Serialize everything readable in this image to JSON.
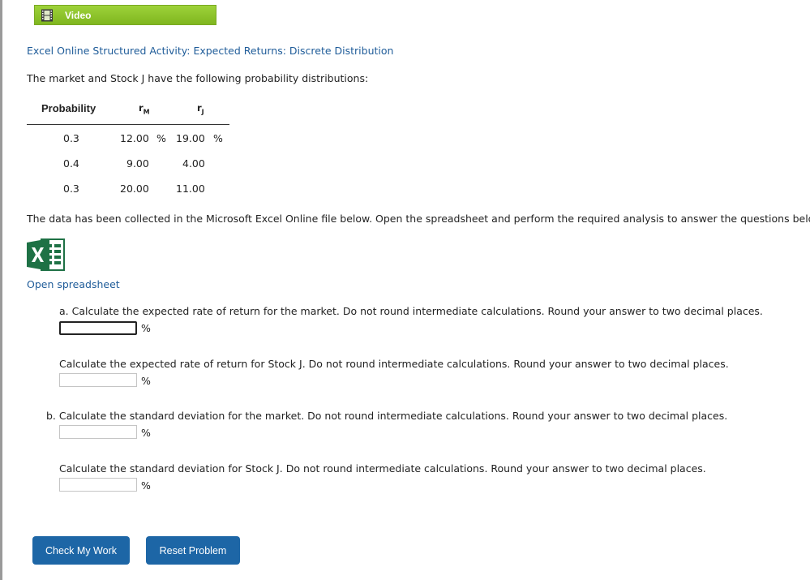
{
  "video": {
    "label": "Video",
    "icon": "film-icon"
  },
  "activity_title": "Excel Online Structured Activity: Expected Returns: Discrete Distribution",
  "intro": "The market and Stock J have the following probability distributions:",
  "table": {
    "header": {
      "probability": "Probability",
      "rm": "r",
      "rm_sub": "M",
      "rj": "r",
      "rj_sub": "J"
    },
    "rows": [
      {
        "prob": "0.3",
        "rm": "12.00",
        "rm_unit": "%",
        "rj": "19.00",
        "rj_unit": "%"
      },
      {
        "prob": "0.4",
        "rm": "9.00",
        "rj": "4.00"
      },
      {
        "prob": "0.3",
        "rm": "20.00",
        "rj": "11.00"
      }
    ]
  },
  "data_note": "The data has been collected in the Microsoft Excel Online file below. Open the spreadsheet and perform the required analysis to answer the questions below.",
  "spreadsheet": {
    "icon": "excel-icon",
    "link_label": "Open spreadsheet"
  },
  "questions": [
    {
      "text": "a. Calculate the expected rate of return for the market. Do not round intermediate calculations. Round your answer to two decimal places.",
      "value": "",
      "unit": "%"
    },
    {
      "text": "Calculate the expected rate of return for Stock J. Do not round intermediate calculations. Round your answer to two decimal places.",
      "value": "",
      "unit": "%"
    },
    {
      "text": "b. Calculate the standard deviation for the market. Do not round intermediate calculations. Round your answer to two decimal places.",
      "value": "",
      "unit": "%"
    },
    {
      "text": "Calculate the standard deviation for Stock J. Do not round intermediate calculations. Round your answer to two decimal places.",
      "value": "",
      "unit": "%"
    }
  ],
  "buttons": {
    "check": "Check My Work",
    "reset": "Reset Problem"
  },
  "colors": {
    "accent_green": "#8cc63f",
    "link_blue": "#1f5c99",
    "button_blue": "#1d66a6"
  }
}
